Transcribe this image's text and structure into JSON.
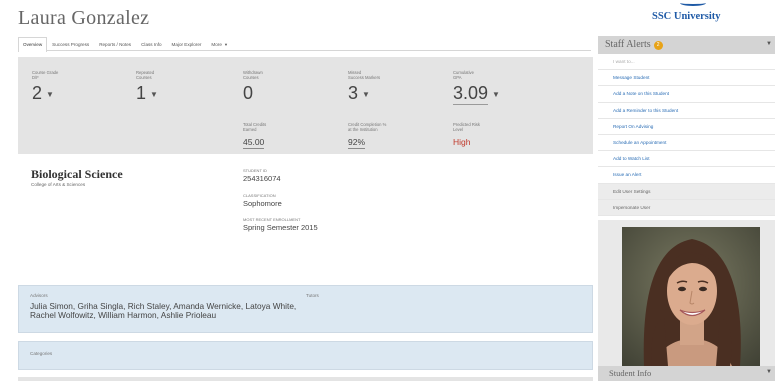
{
  "student": {
    "name": "Laura Gonzalez"
  },
  "brand": {
    "logo_text": "SSC University",
    "color": "#1f5aa6"
  },
  "tabs": [
    {
      "label": "Overview",
      "active": true
    },
    {
      "label": "Success Progress"
    },
    {
      "label": "Reports / Notes"
    },
    {
      "label": "Class Info"
    },
    {
      "label": "Major Explorer"
    },
    {
      "label": "More"
    }
  ],
  "stats": {
    "course_grade": {
      "label_1": "Course Grade",
      "label_2": "D/F",
      "value": "2"
    },
    "repeated_courses": {
      "label_1": "Repeated",
      "label_2": "Courses",
      "value": "1"
    },
    "withdrawn_courses": {
      "label_1": "Withdrawn",
      "label_2": "Courses",
      "value": "0"
    },
    "missed_success_markers": {
      "label_1": "Missed",
      "label_2": "Success Markers",
      "value": "3"
    },
    "cumulative_gpa": {
      "label_1": "Cumulative",
      "label_2": "GPA",
      "value": "3.09"
    },
    "total_credits": {
      "label_1": "Total Credits",
      "label_2": "Earned",
      "value": "45.00"
    },
    "credit_completion": {
      "label_1": "Credit Completion %",
      "label_2": "at the Institution",
      "value": "92%"
    },
    "predicted_risk": {
      "label_1": "Predicted Risk",
      "label_2": "Level",
      "value": "High",
      "color": "#c0392b"
    }
  },
  "profile": {
    "major": "Biological Science",
    "college": "College of Arts & Sciences",
    "student_id_label": "STUDENT ID",
    "student_id": "254316074",
    "classification_label": "CLASSIFICATION",
    "classification": "Sophomore",
    "enrollment_label": "MOST RECENT ENROLLMENT",
    "enrollment": "Spring Semester 2015"
  },
  "advisors": {
    "label": "Advisors",
    "tutors_label": "Tutors",
    "names": "Julia Simon, Griha Singla, Rich Staley, Amanda Wernicke, Latoya White, Rachel Wolfowitz, William Harmon, Ashlie Prioleau"
  },
  "categories": {
    "label": "Categories"
  },
  "staff_alerts": {
    "title": "Staff Alerts",
    "count": "2",
    "placeholder": "I want to...",
    "items": [
      "Message Student",
      "Add a Note on this Student",
      "Add a Reminder to this Student",
      "Report On Advising",
      "Schedule an Appointment",
      "Add to Watch List",
      "Issue an Alert"
    ],
    "settings": [
      "Edit User Settings",
      "Impersonate User"
    ]
  },
  "student_info": {
    "title": "Student Info"
  },
  "icons": {
    "dropdown": "caret-down-icon",
    "panel_toggle": "chevron-down-icon"
  }
}
